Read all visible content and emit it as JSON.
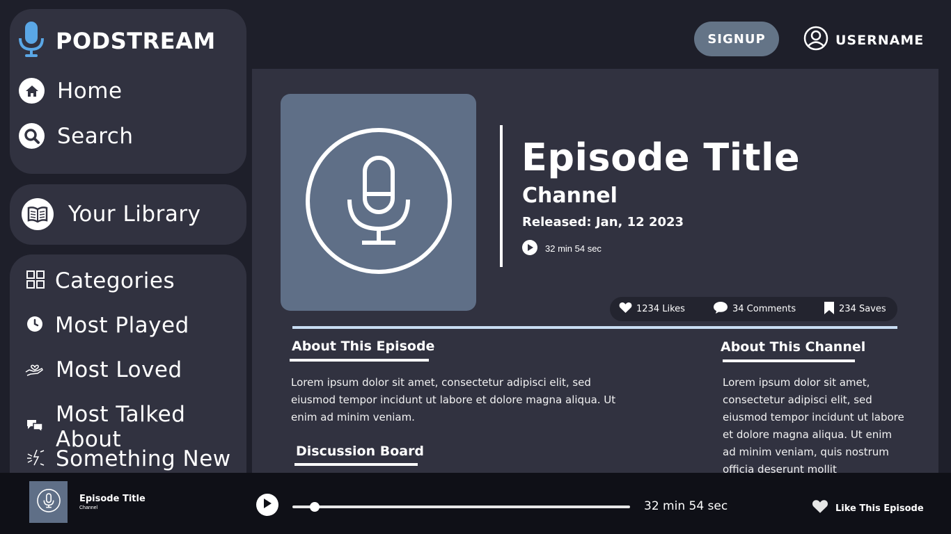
{
  "app": {
    "name": "PODSTREAM"
  },
  "nav": {
    "home": "Home",
    "search": "Search",
    "library": "Your Library"
  },
  "categories": {
    "items": [
      {
        "label": "Categories",
        "icon": "grid-icon"
      },
      {
        "label": "Most Played",
        "icon": "clock-icon"
      },
      {
        "label": "Most Loved",
        "icon": "heart-hand-icon"
      },
      {
        "label": "Most Talked About",
        "icon": "chat-bubbles-icon"
      },
      {
        "label": "Something New",
        "icon": "sparkle-icon"
      }
    ]
  },
  "header": {
    "signup": "SIGNUP",
    "username": "USERNAME"
  },
  "episode": {
    "title": "Episode Title",
    "channel": "Channel",
    "released": "Released: Jan, 12 2023",
    "duration": "32 min 54 sec",
    "likes": "1234 Likes",
    "comments": "34  Comments",
    "saves": "234 Saves"
  },
  "about_episode": {
    "heading": "About This Episode",
    "text": "Lorem ipsum dolor sit amet, consectetur adipisci elit, sed eiusmod tempor incidunt ut labore et dolore magna aliqua. Ut enim ad minim veniam."
  },
  "discussion": {
    "heading": "Discussion Board"
  },
  "about_channel": {
    "heading": "About This Channel",
    "text": "Lorem ipsum dolor sit amet, consectetur adipisci elit, sed eiusmod tempor incidunt ut labore et dolore magna aliqua. Ut enim ad minim veniam, quis nostrum officia deserunt mollit"
  },
  "player": {
    "title": "Episode Title",
    "channel": "Channel",
    "time": "32 min 54 sec",
    "progress": 0.065,
    "like_label": "Like This Episode"
  },
  "colors": {
    "accent": "#c9ddf3",
    "mic_brand": "#5aa7e6",
    "cover": "#5f6f87",
    "panel": "#313240"
  }
}
